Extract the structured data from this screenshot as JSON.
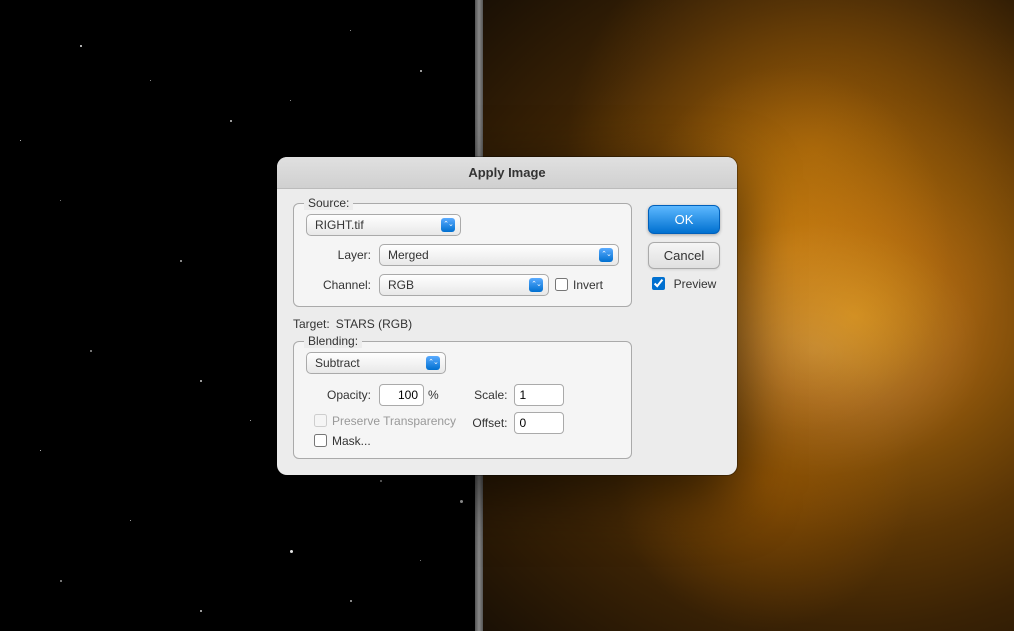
{
  "dialog": {
    "title": "Apply Image",
    "source": {
      "label": "Source:",
      "value": "RIGHT.tif",
      "options": [
        "RIGHT.tif"
      ]
    },
    "layer": {
      "label": "Layer:",
      "value": "Merged",
      "options": [
        "Merged"
      ]
    },
    "channel": {
      "label": "Channel:",
      "value": "RGB",
      "options": [
        "RGB"
      ],
      "invert_label": "Invert",
      "invert_checked": false
    },
    "target": {
      "label": "Target:",
      "value": "STARS (RGB)"
    },
    "blending": {
      "group_label": "Blending:",
      "mode_value": "Subtract",
      "mode_options": [
        "Subtract"
      ],
      "opacity_label": "Opacity:",
      "opacity_value": "100",
      "opacity_unit": "%",
      "preserve_transparency_label": "Preserve Transparency",
      "preserve_transparency_checked": false,
      "preserve_transparency_enabled": false,
      "mask_label": "Mask...",
      "mask_checked": false,
      "scale_label": "Scale:",
      "scale_value": "1",
      "offset_label": "Offset:",
      "offset_value": "0"
    },
    "buttons": {
      "ok": "OK",
      "cancel": "Cancel"
    },
    "preview": {
      "label": "Preview",
      "checked": true
    }
  }
}
